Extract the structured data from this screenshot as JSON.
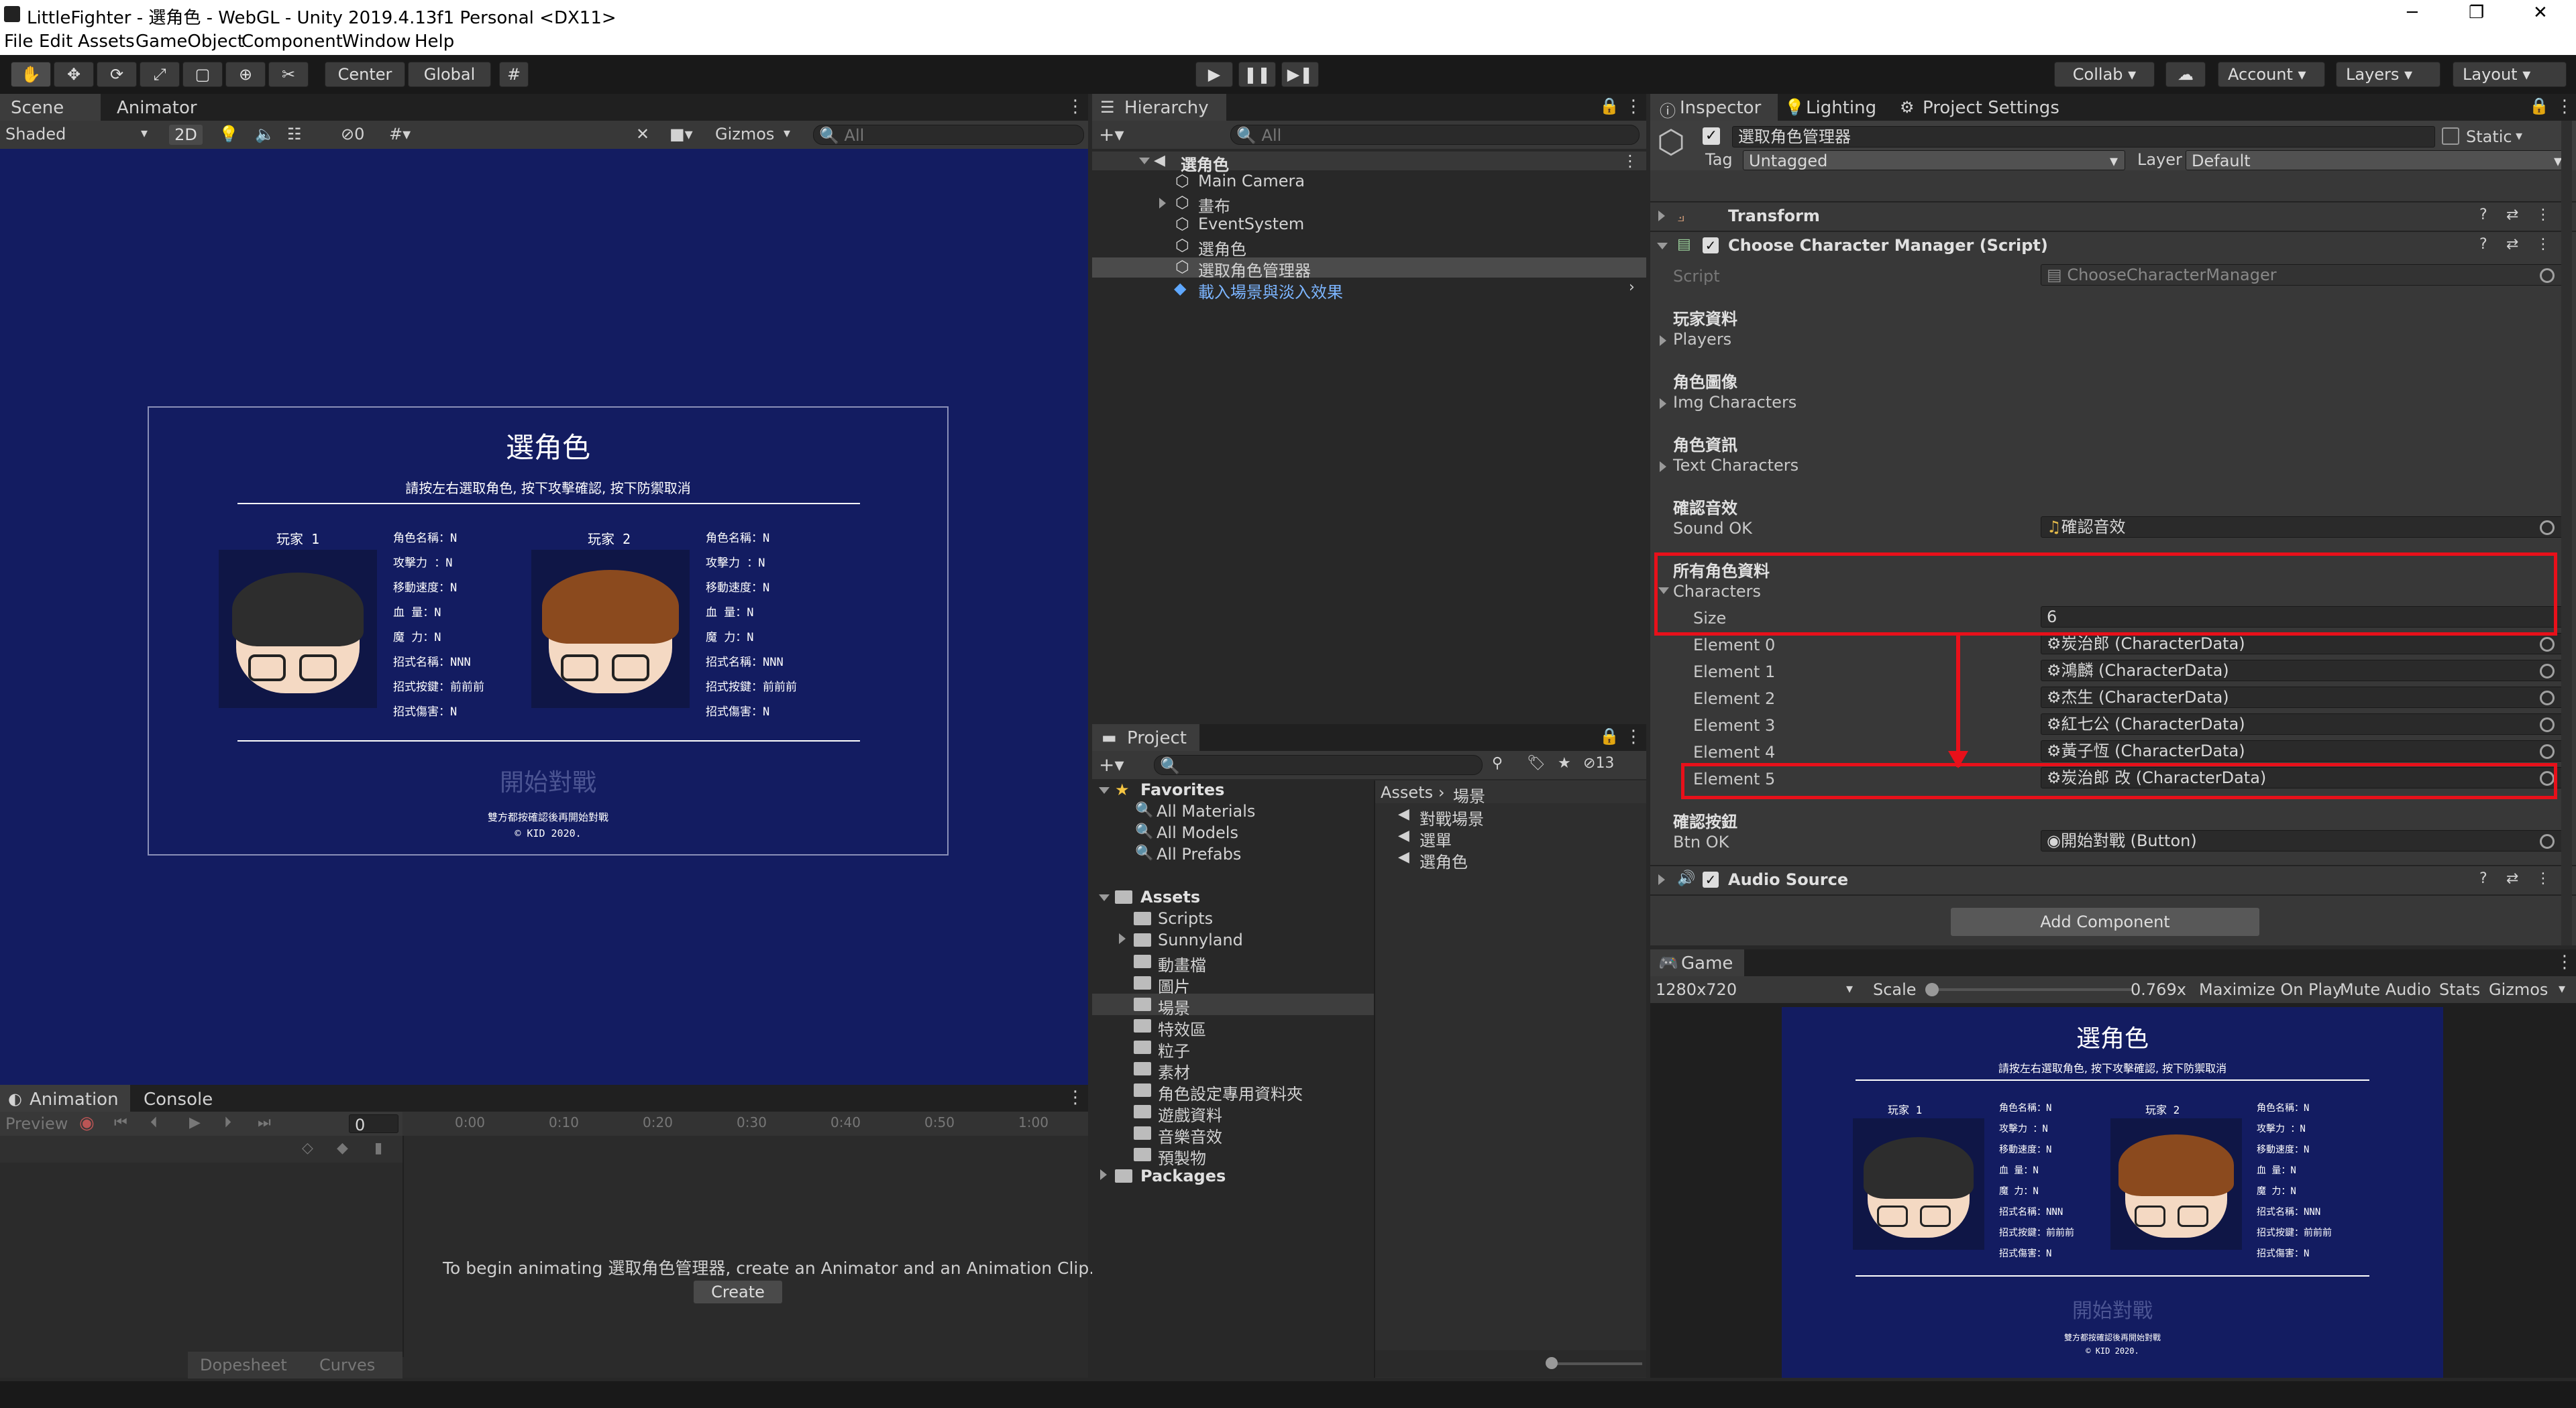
{
  "window": {
    "title": "LittleFighter - 選角色 - WebGL - Unity 2019.4.13f1 Personal <DX11>",
    "minimize": "─",
    "maximize": "❐",
    "close": "✕"
  },
  "menu": [
    "File",
    "Edit",
    "Assets",
    "GameObject",
    "Component",
    "Window",
    "Help"
  ],
  "toolbar": {
    "center": "Center",
    "global": "Global",
    "collab": "Collab ▾",
    "account": "Account",
    "layers": "Layers",
    "layout": "Layout"
  },
  "scene": {
    "tabs": [
      "Scene",
      "Animator"
    ],
    "shading": "Shaded",
    "mode2d": "2D",
    "hidden_count": "0",
    "gizmos": "Gizmos",
    "search_placeholder": "All"
  },
  "game_ui": {
    "title": "選角色",
    "instruction": "請按左右選取角色, 按下攻擊確認, 按下防禦取消",
    "player1": "玩家 1",
    "player2": "玩家 2",
    "stats": [
      "角色名稱：N",
      "攻擊力  ：N",
      "移動速度：N",
      "血    量：N",
      "魔    力：N",
      "招式名稱：NNN",
      "招式按鍵：前前前",
      "招式傷害：N"
    ],
    "start": "開始對戰",
    "footer1": "雙方都按確認後再開始對戰",
    "footer2": "© KID 2020."
  },
  "hierarchy": {
    "tab": "Hierarchy",
    "search_placeholder": "All",
    "scene_name": "選角色",
    "items": [
      "Main Camera",
      "畫布",
      "EventSystem",
      "選角色",
      "選取角色管理器",
      "載入場景與淡入效果"
    ]
  },
  "project": {
    "tab": "Project",
    "hidden_count": "13",
    "favorites_label": "Favorites",
    "favorites": [
      "All Materials",
      "All Models",
      "All Prefabs"
    ],
    "assets_label": "Assets",
    "folders": [
      "Scripts",
      "Sunnyland",
      "動畫檔",
      "圖片",
      "場景",
      "特效區",
      "粒子",
      "素材",
      "角色設定專用資料夾",
      "遊戲資料",
      "音樂音效",
      "預製物"
    ],
    "packages_label": "Packages",
    "breadcrumb": [
      "Assets",
      "場景"
    ],
    "scenes": [
      "對戰場景",
      "選單",
      "選角色"
    ]
  },
  "animation": {
    "tabs": [
      "Animation",
      "Console"
    ],
    "preview": "Preview",
    "frame": "0",
    "ticks": [
      "0:00",
      "0:10",
      "0:20",
      "0:30",
      "0:40",
      "0:50",
      "1:00"
    ],
    "message": "To begin animating 選取角色管理器, create an Animator and an Animation Clip.",
    "create": "Create",
    "dopesheet": "Dopesheet",
    "curves": "Curves"
  },
  "inspector": {
    "tabs": [
      "Inspector",
      "Lighting",
      "Project Settings"
    ],
    "object_name": "選取角色管理器",
    "static_label": "Static",
    "tag_label": "Tag",
    "tag_value": "Untagged",
    "layer_label": "Layer",
    "layer_value": "Default",
    "transform": "Transform",
    "script_component": "Choose Character Manager (Script)",
    "script_label": "Script",
    "script_value": "ChooseCharacterManager",
    "sections": [
      {
        "header": "玩家資料",
        "field": "Players"
      },
      {
        "header": "角色圖像",
        "field": "Img Characters"
      },
      {
        "header": "角色資訊",
        "field": "Text Characters"
      }
    ],
    "sound_header": "確認音效",
    "sound_label": "Sound OK",
    "sound_value": "確認音效",
    "all_header": "所有角色資料",
    "characters_label": "Characters",
    "size_label": "Size",
    "size_value": "6",
    "elements": [
      {
        "label": "Element 0",
        "value": "炭治郎 (CharacterData)"
      },
      {
        "label": "Element 1",
        "value": "鴻麟 (CharacterData)"
      },
      {
        "label": "Element 2",
        "value": "杰生 (CharacterData)"
      },
      {
        "label": "Element 3",
        "value": "紅七公 (CharacterData)"
      },
      {
        "label": "Element 4",
        "value": "黃子恆 (CharacterData)"
      },
      {
        "label": "Element 5",
        "value": "炭治郎 改 (CharacterData)"
      }
    ],
    "btn_header": "確認按鈕",
    "btn_label": "Btn OK",
    "btn_value": "開始對戰 (Button)",
    "audio_source": "Audio Source",
    "add_component": "Add Component"
  },
  "game_view": {
    "tab": "Game",
    "resolution": "1280x720",
    "scale_label": "Scale",
    "scale_value": "0.769x",
    "scale_fraction": 0.0,
    "options": [
      "Maximize On Play",
      "Mute Audio",
      "Stats",
      "Gizmos"
    ]
  },
  "colors": {
    "accent_red": "#e8101a",
    "game_bg": "#131c61",
    "selected_blue": "#5fa8ff"
  }
}
